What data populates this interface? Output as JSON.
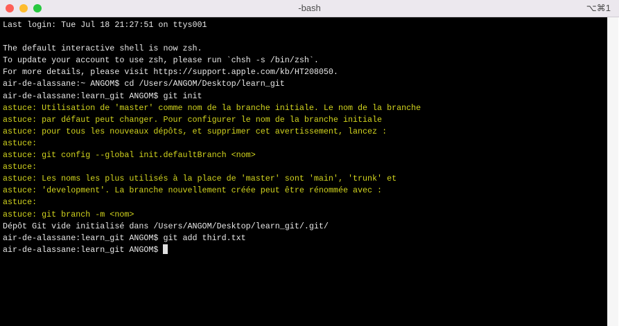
{
  "window": {
    "title": "-bash",
    "shortcut": "⌥⌘1",
    "colors": {
      "close": "#fe5f57",
      "minimize": "#febc2e",
      "zoom": "#28c840"
    }
  },
  "terminal": {
    "lines": [
      {
        "text": "Last login: Tue Jul 18 21:27:51 on ttys001",
        "kind": "w"
      },
      {
        "text": "",
        "kind": "w"
      },
      {
        "text": "The default interactive shell is now zsh.",
        "kind": "w"
      },
      {
        "text": "To update your account to use zsh, please run `chsh -s /bin/zsh`.",
        "kind": "w"
      },
      {
        "text": "For more details, please visit https://support.apple.com/kb/HT208050.",
        "kind": "w"
      },
      {
        "text": "air-de-alassane:~ ANGOM$ cd /Users/ANGOM/Desktop/learn_git",
        "kind": "w"
      },
      {
        "text": "air-de-alassane:learn_git ANGOM$ git init",
        "kind": "w"
      },
      {
        "text": "astuce: Utilisation de 'master' comme nom de la branche initiale. Le nom de la branche",
        "kind": "y"
      },
      {
        "text": "astuce: par défaut peut changer. Pour configurer le nom de la branche initiale",
        "kind": "y"
      },
      {
        "text": "astuce: pour tous les nouveaux dépôts, et supprimer cet avertissement, lancez :",
        "kind": "y"
      },
      {
        "text": "astuce:",
        "kind": "y"
      },
      {
        "text": "astuce: \tgit config --global init.defaultBranch <nom>",
        "kind": "y"
      },
      {
        "text": "astuce:",
        "kind": "y"
      },
      {
        "text": "astuce: Les noms les plus utilisés à la place de 'master' sont 'main', 'trunk' et",
        "kind": "y"
      },
      {
        "text": "astuce: 'development'. La branche nouvellement créée peut être rénommée avec :",
        "kind": "y"
      },
      {
        "text": "astuce:",
        "kind": "y"
      },
      {
        "text": "astuce: \tgit branch -m <nom>",
        "kind": "y"
      },
      {
        "text": "Dépôt Git vide initialisé dans /Users/ANGOM/Desktop/learn_git/.git/",
        "kind": "w"
      },
      {
        "text": "air-de-alassane:learn_git ANGOM$ git add third.txt",
        "kind": "w"
      }
    ],
    "prompt": "air-de-alassane:learn_git ANGOM$ "
  }
}
